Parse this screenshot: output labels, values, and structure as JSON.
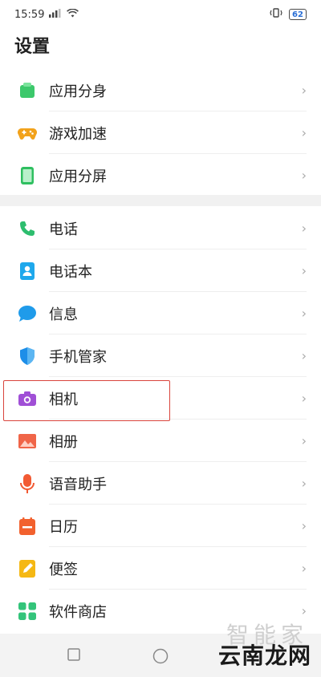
{
  "status_bar": {
    "time": "15:59",
    "signal_text": "ıll",
    "battery": "62"
  },
  "page": {
    "title": "设置"
  },
  "groups": [
    {
      "items": [
        {
          "label": "应用分身",
          "icon": "app-clone-icon",
          "color": "#3cc86b"
        },
        {
          "label": "游戏加速",
          "icon": "gamepad-icon",
          "color": "#f2a21b"
        },
        {
          "label": "应用分屏",
          "icon": "split-screen-icon",
          "color": "#2fbf60"
        }
      ]
    },
    {
      "items": [
        {
          "label": "电话",
          "icon": "phone-icon",
          "color": "#2dbd6e"
        },
        {
          "label": "电话本",
          "icon": "contacts-icon",
          "color": "#1ea8ec"
        },
        {
          "label": "信息",
          "icon": "message-icon",
          "color": "#1f9bea"
        },
        {
          "label": "手机管家",
          "icon": "shield-icon",
          "color": "#1d8ee8"
        },
        {
          "label": "相机",
          "icon": "camera-icon",
          "color": "#a04fd6"
        },
        {
          "label": "相册",
          "icon": "gallery-icon",
          "color": "#f06548"
        },
        {
          "label": "语音助手",
          "icon": "mic-icon",
          "color": "#f25a33"
        },
        {
          "label": "日历",
          "icon": "calendar-icon",
          "color": "#f2612e"
        },
        {
          "label": "便签",
          "icon": "notes-icon",
          "color": "#f5b814"
        },
        {
          "label": "软件商店",
          "icon": "store-icon",
          "color": "#33c47a"
        }
      ]
    }
  ],
  "chevron": "›",
  "watermark": {
    "main": "云南龙网",
    "faded": "智能家"
  },
  "nav": {
    "recent_icon": "square-icon",
    "home_icon": "circle-icon"
  }
}
